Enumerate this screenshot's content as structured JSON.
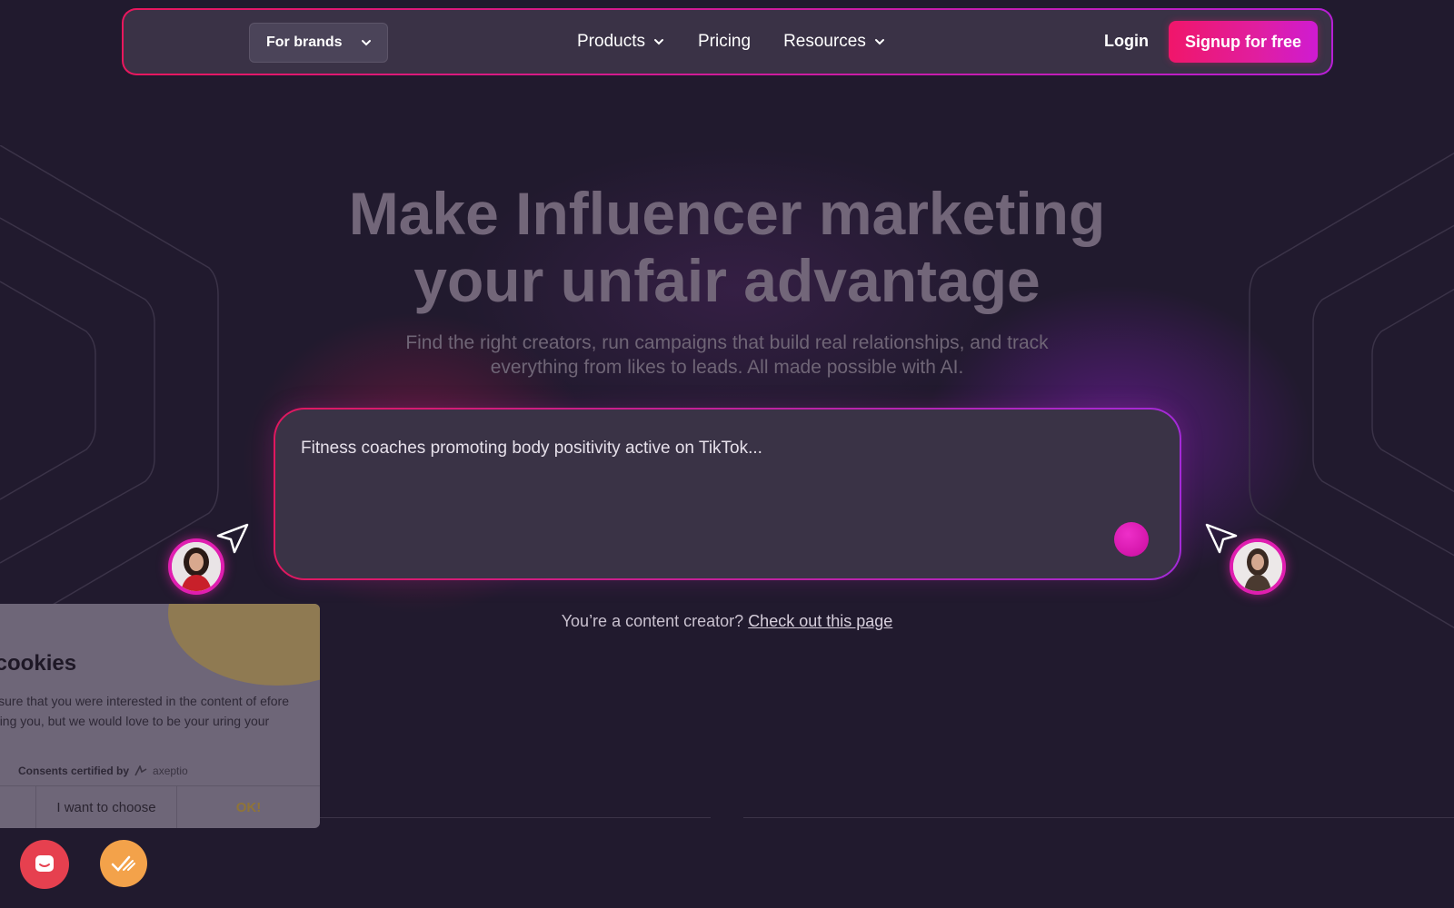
{
  "nav": {
    "audience_select": "For brands",
    "links": [
      {
        "label": "Products",
        "has_dropdown": true
      },
      {
        "label": "Pricing",
        "has_dropdown": false
      },
      {
        "label": "Resources",
        "has_dropdown": true
      }
    ],
    "login": "Login",
    "signup": "Signup for free"
  },
  "hero": {
    "title_line1": "Make Influencer marketing",
    "title_line2": "your unfair advantage",
    "subtitle_line1": "Find the right creators, run campaigns that build real relationships, and track",
    "subtitle_line2": "everything from likes to leads. All made possible with AI.",
    "search_placeholder": "Fitness coaches promoting body positivity active on TikTok...",
    "creator_prompt": "You’re a content creator?",
    "creator_link": "Check out this page"
  },
  "cookie_banner": {
    "title": "ne cookies",
    "text": "make sure that you were interested in the content of efore bothering you, but we would love to be your uring your visit...",
    "certified_by": "Consents certified by",
    "certifier": "axeptio",
    "choose_label": "I want to choose",
    "ok_label": "OK!"
  },
  "colors": {
    "background": "#211a2e",
    "accent_pink": "#f0166a",
    "accent_purple": "#cf1bd2",
    "chat_button": "#e6404f",
    "consent_button": "#f3a24a"
  }
}
